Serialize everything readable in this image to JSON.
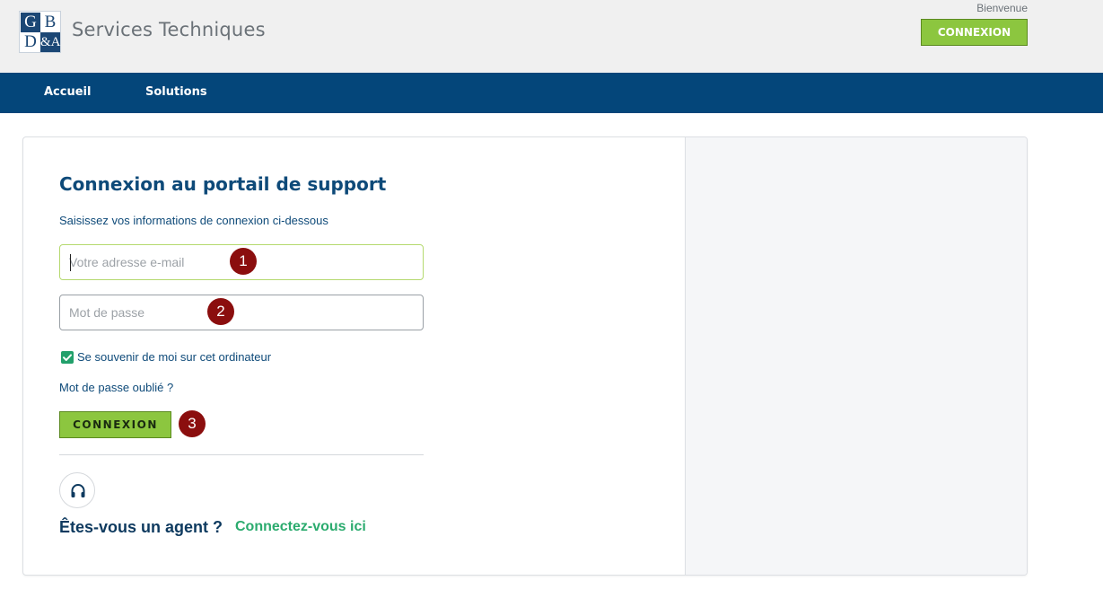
{
  "header": {
    "logo": {
      "letters": [
        "G",
        "B",
        "D",
        "&A"
      ]
    },
    "brand_name": "Services Techniques",
    "welcome_text": "Bienvenue",
    "login_button_label": "CONNEXION",
    "accent_color": "#8cc63f"
  },
  "nav": {
    "items": [
      {
        "label": "Accueil"
      },
      {
        "label": "Solutions"
      }
    ],
    "background_color": "#04467a"
  },
  "login": {
    "title": "Connexion au portail de support",
    "subtitle": "Saisissez vos informations de connexion ci-dessous",
    "email": {
      "placeholder": "Votre adresse e-mail",
      "value": ""
    },
    "password": {
      "placeholder": "Mot de passe",
      "value": ""
    },
    "remember_me": {
      "label": "Se souvenir de moi sur cet ordinateur",
      "checked": true
    },
    "forgot_password_label": "Mot de passe oublié ?",
    "submit_label": "CONNEXION",
    "annotations": [
      "1",
      "2",
      "3"
    ],
    "agent": {
      "icon": "headset-icon",
      "question": "Êtes-vous un agent ?",
      "link_label": "Connectez-vous ici"
    }
  }
}
